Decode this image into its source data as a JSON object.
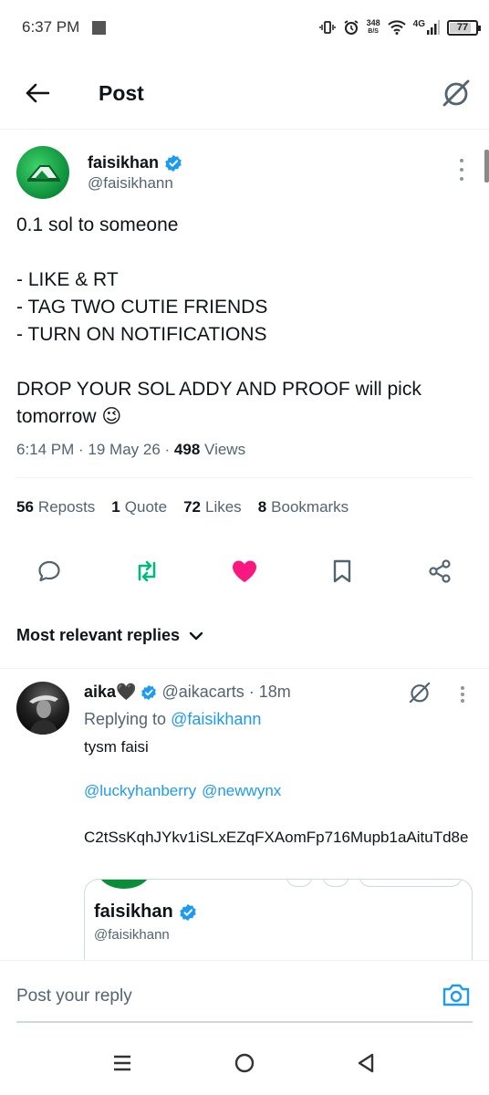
{
  "status_bar": {
    "time": "6:37 PM",
    "net_speed_value": "348",
    "net_speed_unit": "B/S",
    "network": "4G",
    "battery": "77"
  },
  "header": {
    "title": "Post"
  },
  "post": {
    "author_name": "faisikhan",
    "author_handle": "@faisikhann",
    "text": "0.1 sol to someone\n\n- LIKE & RT\n- TAG TWO CUTIE FRIENDS\n- TURN ON NOTIFICATIONS\n\nDROP YOUR SOL ADDY AND PROOF will pick tomorrow 😉",
    "time": "6:14 PM",
    "date": "19 May 26",
    "views_count": "498",
    "views_label": "Views",
    "stats": {
      "reposts_count": "56",
      "reposts_label": "Reposts",
      "quotes_count": "1",
      "quotes_label": "Quote",
      "likes_count": "72",
      "likes_label": "Likes",
      "bookmarks_count": "8",
      "bookmarks_label": "Bookmarks"
    }
  },
  "replies_section": {
    "sort_label": "Most relevant replies"
  },
  "reply": {
    "author_name": "aika🖤",
    "author_handle": "@aikacarts",
    "time": "· 18m",
    "replying_prefix": "Replying to",
    "replying_to": "@faisikhann",
    "text": "tysm faisi",
    "mention_1": "@luckyhanberry",
    "mention_2": "@newwynx",
    "address": "C2tSsKqhJYkv1iSLxEZqFXAomFp716Mupb1aAituTd8e",
    "quote": {
      "author_name": "faisikhan",
      "author_handle": "@faisikhann"
    }
  },
  "reply_bar": {
    "placeholder": "Post your reply"
  },
  "icons": {
    "accent": "#1d9bf0",
    "like": "#f91880",
    "repost": "#00ba7c"
  }
}
